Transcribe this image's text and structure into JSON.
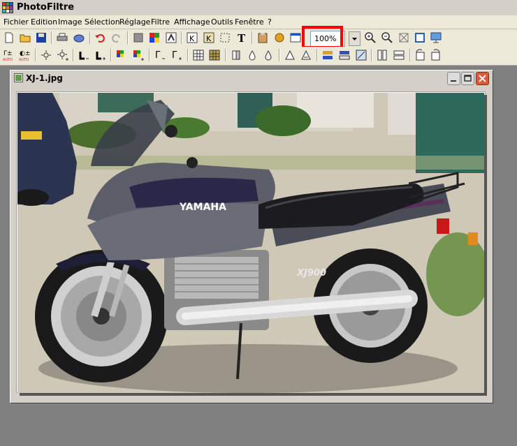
{
  "app": {
    "title": "PhotoFiltre",
    "icon": "photofiltre-app-icon"
  },
  "menu": {
    "items": [
      "Fichier",
      "Edition",
      "Image",
      "Sélection",
      "Réglage",
      "Filtre",
      "Affichage",
      "Outils",
      "Fenêtre",
      "?"
    ]
  },
  "toolbar": {
    "zoom_value": "100%",
    "zoom_highlight_color": "#ff0000",
    "row1_icons": [
      "new-file-icon",
      "open-folder-icon",
      "save-icon",
      "print-icon",
      "scan-icon",
      "undo-icon",
      "redo-icon",
      "grey-square-icon",
      "color-palette-icon",
      "effect-icon",
      "cut-icon",
      "copy-icon",
      "selection-crop-icon",
      "text-icon",
      "clipboard-icon",
      "puzzle-icon",
      "window-icon",
      "zoom-in-icon",
      "zoom-out-icon",
      "fit-window-icon",
      "full-screen-icon",
      "slideshow-icon"
    ],
    "row2_icons": [
      "auto-levels-icon",
      "auto-contrast-icon",
      "brightness-minus-icon",
      "brightness-plus-icon",
      "contrast-minus-icon",
      "contrast-plus-icon",
      "saturation-minus-icon",
      "saturation-plus-icon",
      "gamma-minus-icon",
      "gamma-plus-icon",
      "color-grid-icon",
      "color-grid-alt-icon",
      "blur-icon",
      "drop-icon",
      "drop-outline-icon",
      "sharpen-icon",
      "sharpen-plus-icon",
      "flip-horizontal-icon",
      "flip-vertical-icon",
      "transform-icon",
      "columns-icon",
      "rows-icon",
      "rotate-left-icon",
      "rotate-right-icon"
    ]
  },
  "document": {
    "title": "XJ-1.jpg",
    "minimize_label": "_",
    "maximize_label": "□",
    "close_label": "✕"
  },
  "photo": {
    "brand_text": "YAMAHA",
    "model_text": "XJ900"
  }
}
